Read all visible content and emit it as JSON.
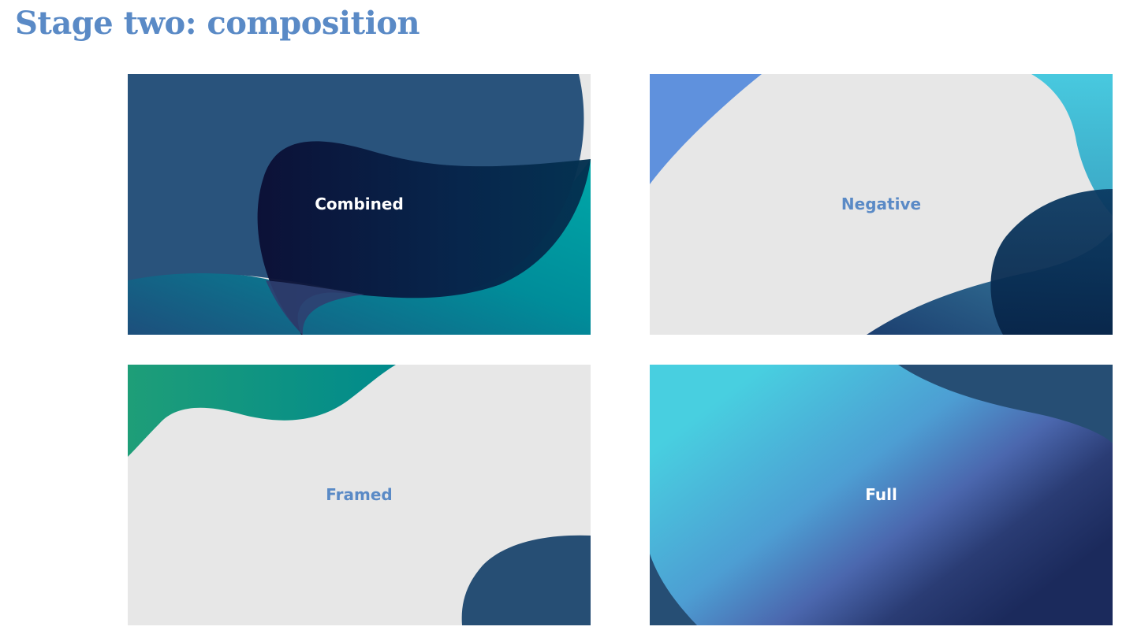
{
  "title": "Stage two: composition",
  "tiles": [
    {
      "label": "Combined"
    },
    {
      "label": "Negative"
    },
    {
      "label": "Framed"
    },
    {
      "label": "Full"
    }
  ],
  "colors": {
    "heading": "#5a8ac6",
    "tile_background": "#e7e7e7",
    "navy": "#29537c",
    "deep_navy": "#0b1136",
    "teal": "#00a5a6",
    "cyan": "#48c9df",
    "sky_blue": "#5f91dd",
    "green": "#1e9e78",
    "label_light": "#ffffff",
    "label_blue": "#5a8ac6"
  }
}
